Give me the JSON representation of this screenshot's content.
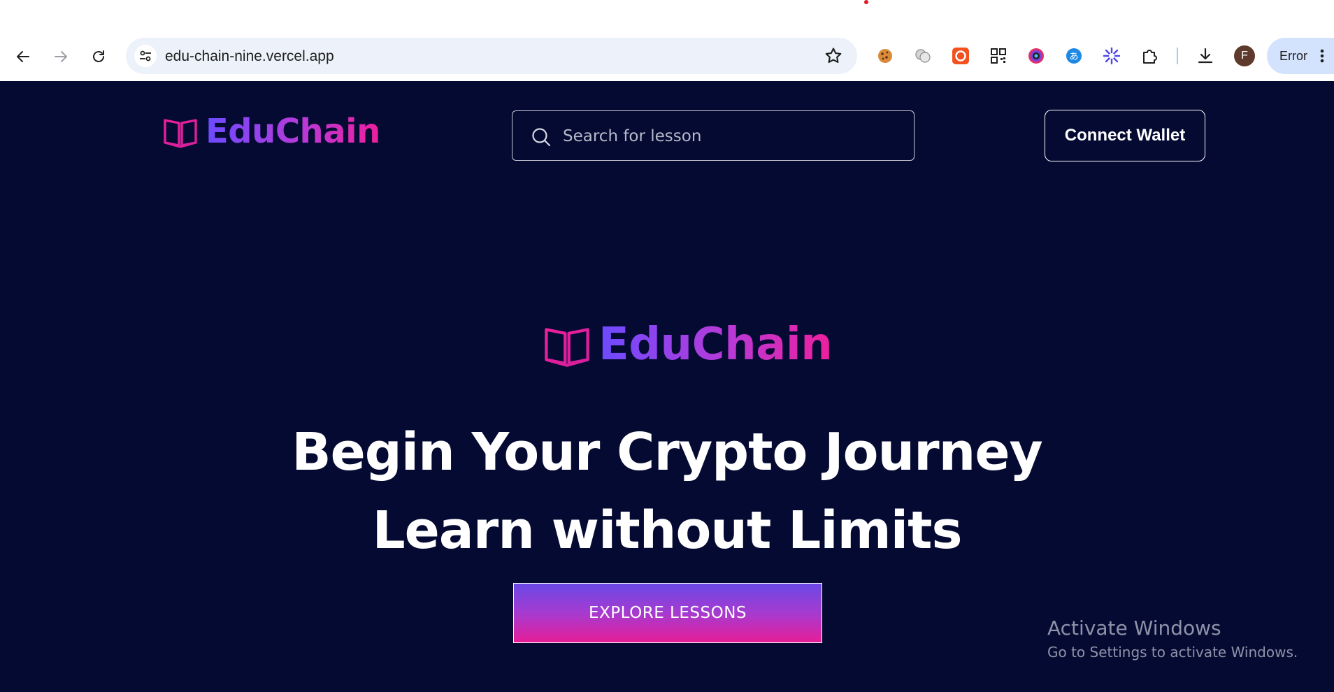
{
  "browser": {
    "url": "edu-chain-nine.vercel.app",
    "profile_initial": "F",
    "error_label": "Error",
    "icons": {
      "back": "arrow-left-icon",
      "forward": "arrow-right-icon",
      "reload": "reload-icon",
      "site_info": "tune-icon",
      "bookmark": "star-icon",
      "extensions": [
        "cookie-icon",
        "blob-icon",
        "record-icon",
        "qr-code-icon",
        "color-picker-icon",
        "translate-icon",
        "sparkle-icon",
        "puzzle-icon"
      ],
      "download": "download-icon",
      "menu": "kebab-icon"
    }
  },
  "header": {
    "brand": "EduChain",
    "search_placeholder": "Search for lesson",
    "connect_label": "Connect Wallet"
  },
  "hero": {
    "brand": "EduChain",
    "line1": "Begin Your Crypto Journey",
    "line2": "Learn without Limits",
    "cta_label": "EXPLORE LESSONS"
  },
  "watermark": {
    "title": "Activate Windows",
    "subtitle": "Go to Settings to activate Windows."
  },
  "colors": {
    "page_bg": "#050a33",
    "brand_gradient_start": "#6c4bff",
    "brand_gradient_end": "#ee1f9c",
    "cta_gradient_top": "#6a48e6",
    "cta_gradient_bottom": "#e61d98"
  }
}
